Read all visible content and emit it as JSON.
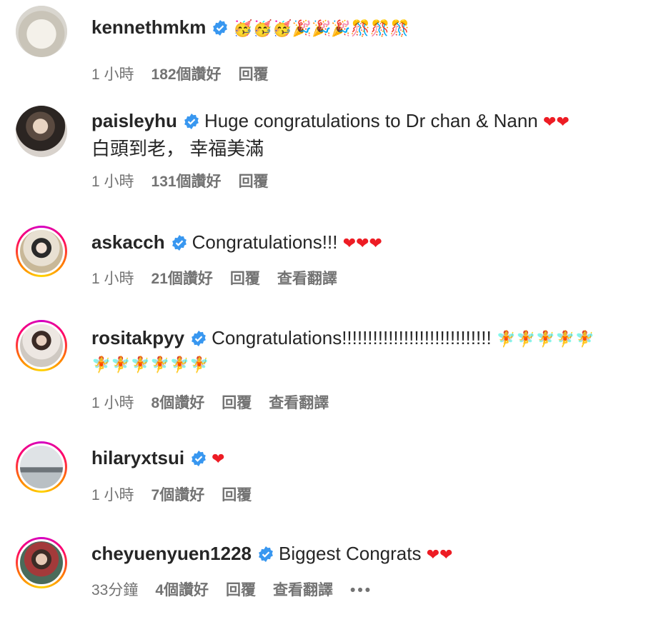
{
  "comments": [
    {
      "username": "kennethmkm",
      "text": "",
      "emoji": "🥳🥳🥳🎉🎉🎉🎊🎊🎊",
      "time": "1 小時",
      "likes": "182個讚好",
      "reply": "回覆",
      "translate": ""
    },
    {
      "username": "paisleyhu",
      "text": "Huge congratulations to Dr chan & Nann",
      "emoji": "❤❤",
      "text2": "白頭到老， 幸福美滿",
      "time": "1 小時",
      "likes": "131個讚好",
      "reply": "回覆",
      "translate": ""
    },
    {
      "username": "askacch",
      "text": "Congratulations!!!",
      "emoji": "❤❤❤",
      "time": "1 小時",
      "likes": "21個讚好",
      "reply": "回覆",
      "translate": "查看翻譯"
    },
    {
      "username": "rositakpyy",
      "text": "Congratulations!!!!!!!!!!!!!!!!!!!!!!!!!!!!!",
      "emoji": "🧚🧚🧚🧚🧚",
      "emoji2": "🧚🧚🧚🧚🧚🧚",
      "time": "1 小時",
      "likes": "8個讚好",
      "reply": "回覆",
      "translate": "查看翻譯"
    },
    {
      "username": "hilaryxtsui",
      "text": "",
      "emoji": "❤",
      "time": "1 小時",
      "likes": "7個讚好",
      "reply": "回覆",
      "translate": ""
    },
    {
      "username": "cheyuenyuen1228",
      "text": "Biggest Congrats",
      "emoji": "❤❤",
      "time": "33分鐘",
      "likes": "4個讚好",
      "reply": "回覆",
      "translate": "查看翻譯",
      "more": "•••"
    }
  ],
  "colors": {
    "verified": "#3897f0",
    "heart": "#ed1c24",
    "meta": "#737373"
  }
}
